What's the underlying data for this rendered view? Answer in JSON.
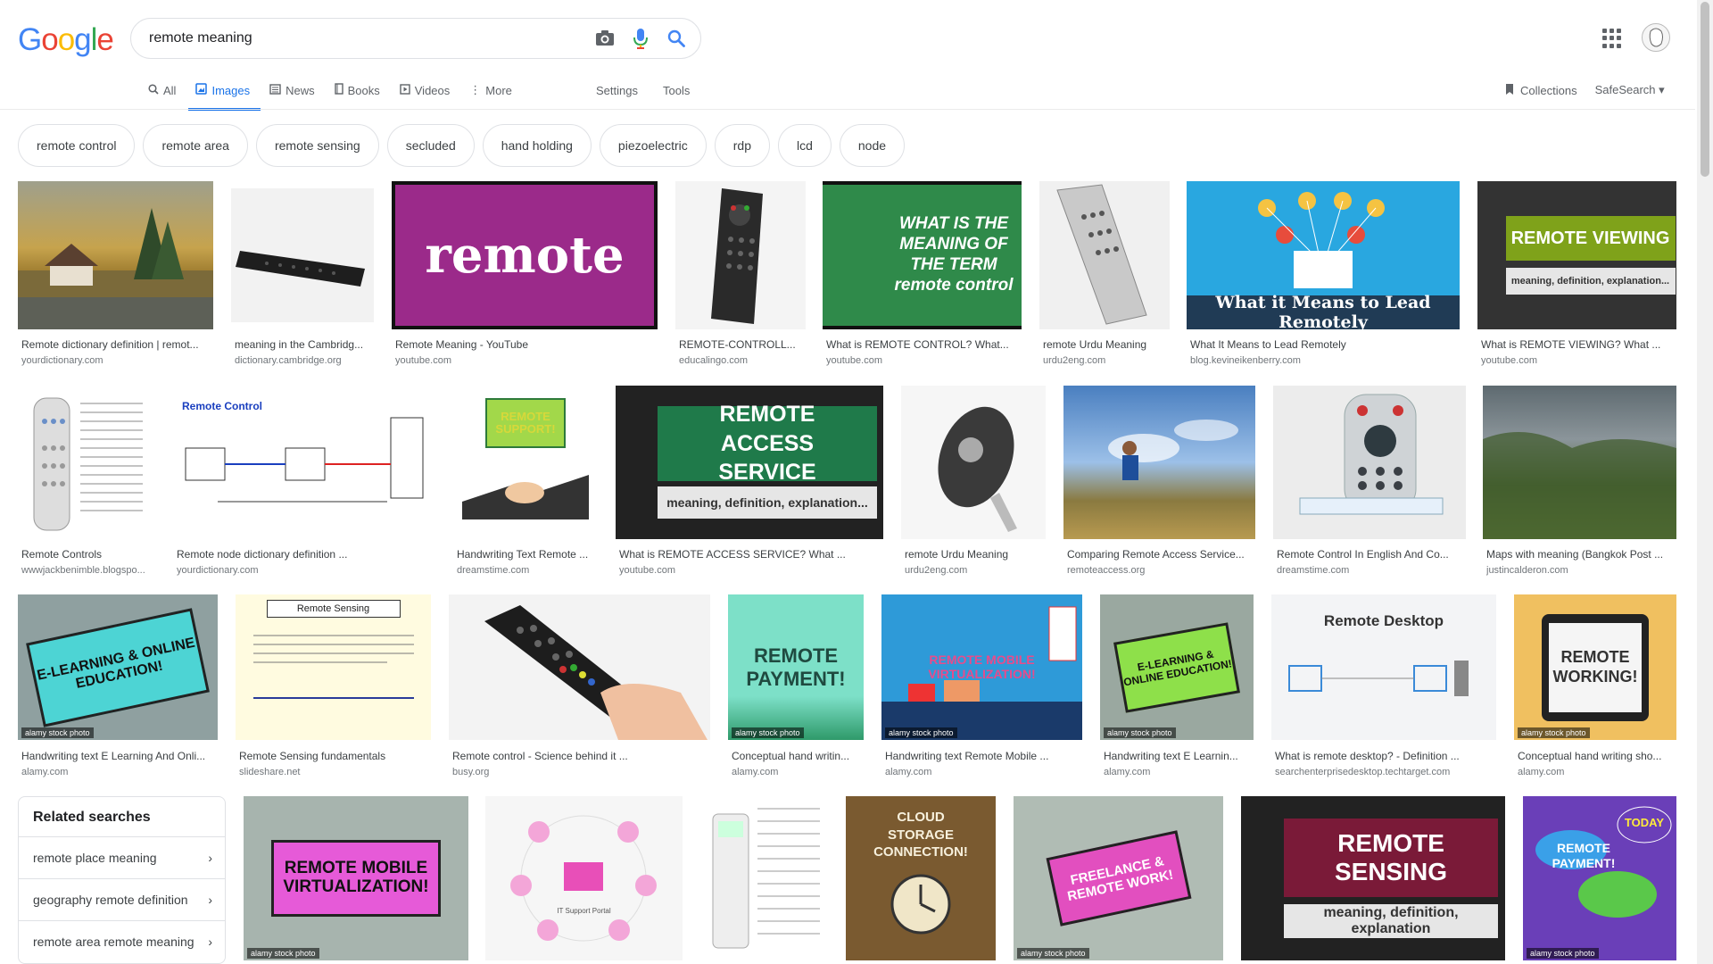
{
  "logo": {
    "letters": [
      "G",
      "o",
      "o",
      "g",
      "l",
      "e"
    ],
    "colors": [
      "#4285f4",
      "#ea4335",
      "#fbbc05",
      "#4285f4",
      "#34a853",
      "#ea4335"
    ]
  },
  "search": {
    "query": "remote meaning"
  },
  "tabs": [
    {
      "label": "All",
      "icon": "search-icon"
    },
    {
      "label": "Images",
      "icon": "image-icon",
      "active": true
    },
    {
      "label": "News",
      "icon": "news-icon"
    },
    {
      "label": "Books",
      "icon": "book-icon"
    },
    {
      "label": "Videos",
      "icon": "play-icon"
    },
    {
      "label": "More",
      "icon": "more-dots-icon"
    }
  ],
  "tools": {
    "settings": "Settings",
    "tools": "Tools",
    "collections": "Collections",
    "safesearch": "SafeSearch"
  },
  "chips": [
    "remote control",
    "remote area",
    "remote sensing",
    "secluded",
    "hand holding",
    "piezoelectric",
    "rdp",
    "lcd",
    "node"
  ],
  "row1": [
    {
      "title": "Remote dictionary definition | remot...",
      "source": "yourdictionary.com"
    },
    {
      "title": "meaning in the Cambridg...",
      "source": "dictionary.cambridge.org"
    },
    {
      "title": "Remote Meaning - YouTube",
      "source": "youtube.com",
      "overlay": "remote"
    },
    {
      "title": "REMOTE-CONTROLL...",
      "source": "educalingo.com"
    },
    {
      "title": "What is REMOTE CONTROL? What...",
      "source": "youtube.com",
      "overlay": "WHAT IS THE MEANING OF THE TERM remote control"
    },
    {
      "title": "remote Urdu Meaning",
      "source": "urdu2eng.com"
    },
    {
      "title": "What It Means to Lead Remotely",
      "source": "blog.kevineikenberry.com",
      "overlay": "What it Means to Lead Remotely"
    },
    {
      "title": "What is REMOTE VIEWING? What ...",
      "source": "youtube.com",
      "overlay": "REMOTE VIEWING",
      "overlay2": "meaning, definition, explanation..."
    }
  ],
  "row2": [
    {
      "title": "Remote Controls",
      "source": "wwwjackbenimble.blogspo..."
    },
    {
      "title": "Remote node dictionary definition ...",
      "source": "yourdictionary.com",
      "overlay": "Remote Control"
    },
    {
      "title": "Handwriting Text Remote ...",
      "source": "dreamstime.com",
      "overlay": "REMOTE SUPPORT!"
    },
    {
      "title": "What is REMOTE ACCESS SERVICE? What ...",
      "source": "youtube.com",
      "overlay": "REMOTE ACCESS SERVICE",
      "overlay2": "meaning, definition, explanation..."
    },
    {
      "title": "remote Urdu Meaning",
      "source": "urdu2eng.com"
    },
    {
      "title": "Comparing Remote Access Service...",
      "source": "remoteaccess.org"
    },
    {
      "title": "Remote Control In English And Co...",
      "source": "dreamstime.com"
    },
    {
      "title": "Maps with meaning (Bangkok Post ...",
      "source": "justincalderon.com"
    }
  ],
  "row3": [
    {
      "title": "Handwriting text E Learning And Onli...",
      "source": "alamy.com",
      "overlay": "E-LEARNING & ONLINE EDUCATION!"
    },
    {
      "title": "Remote Sensing fundamentals",
      "source": "slideshare.net",
      "overlay": "Remote Sensing"
    },
    {
      "title": "Remote control - Science behind it ...",
      "source": "busy.org"
    },
    {
      "title": "Conceptual hand writin...",
      "source": "alamy.com",
      "overlay": "REMOTE PAYMENT!"
    },
    {
      "title": "Handwriting text Remote Mobile ...",
      "source": "alamy.com",
      "overlay": "REMOTE MOBILE VIRTUALIZATION!"
    },
    {
      "title": "Handwriting text E Learnin...",
      "source": "alamy.com",
      "overlay": "E-LEARNING & ONLINE EDUCATION!"
    },
    {
      "title": "What is remote desktop? - Definition ...",
      "source": "searchenterprisedesktop.techtarget.com",
      "overlay": "Remote Desktop"
    },
    {
      "title": "Conceptual hand writing sho...",
      "source": "alamy.com",
      "overlay": "REMOTE WORKING!"
    }
  ],
  "row4": [
    {
      "overlay": "REMOTE MOBILE VIRTUALIZATION!"
    },
    {
      "overlay": "IT Support Portal"
    },
    {
      "overlay": ""
    },
    {
      "overlay": "CLOUD STORAGE CONNECTION!"
    },
    {
      "overlay": "FREELANCE & REMOTE WORK!"
    },
    {
      "overlay": "REMOTE SENSING",
      "overlay2": "meaning, definition, explanation"
    },
    {
      "overlay": "REMOTE PAYMENT!",
      "overlay2": "TODAY"
    }
  ],
  "stock_label": "alamy stock photo",
  "related": {
    "heading": "Related searches",
    "items": [
      "remote place meaning",
      "geography remote definition",
      "remote area remote meaning"
    ]
  },
  "colors": {
    "accent": "#1a73e8",
    "text": "#202124",
    "muted": "#70757a"
  }
}
